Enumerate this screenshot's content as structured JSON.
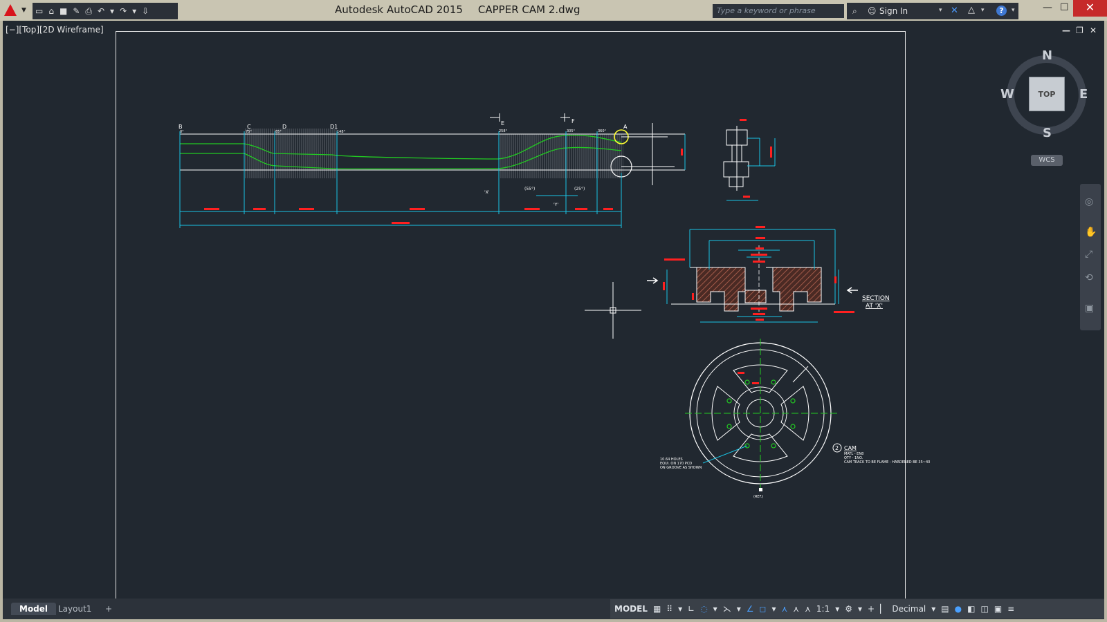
{
  "app": {
    "name": "Autodesk AutoCAD 2015",
    "file": "CAPPER CAM 2.dwg"
  },
  "search": {
    "placeholder": "Type a keyword or phrase"
  },
  "account": {
    "sign_in": "Sign In"
  },
  "viewport": {
    "label": "[−][Top][2D Wireframe]"
  },
  "viewcube": {
    "top": "TOP",
    "north": "N",
    "south": "S",
    "east": "E",
    "west": "W",
    "wcs": "WCS"
  },
  "tabs": [
    {
      "label": "Model"
    },
    {
      "label": "Layout1"
    },
    {
      "label": "+"
    }
  ],
  "status": {
    "model": "MODEL",
    "scale": "1:1",
    "units": "Decimal"
  },
  "drawing": {
    "top_labels": [
      "B",
      "C",
      "D",
      "D1",
      "E",
      "F",
      "A"
    ],
    "angle_labels": [
      "0°",
      "75°",
      "85°",
      "148°",
      "258°",
      "305°",
      "360°"
    ],
    "section_title": "SECTION",
    "section_sub": "AT 'X'",
    "cam_title": "CAM",
    "cam_notes": [
      "MATL - EN8",
      "QTY - 1NO.",
      "CAM TRACK TO BE FLAME - HARDENED BE 35~40"
    ],
    "hole_notes": [
      "10.64 HOLES",
      "EQUI. ON 170 PCD",
      "ON GROOVE AS SHOWN"
    ],
    "ref_mark": "(REF.)",
    "x_mark": "'X'",
    "y_mark": "'Y'",
    "dim_55": "(55°)",
    "dim_25": "(25°)"
  },
  "colors": {
    "background": "#212830",
    "geometry": "#ffffff",
    "curve": "#22cc22",
    "dimension": "#19c5e6",
    "text_red": "#ff2020",
    "hatch": "#a05040"
  }
}
